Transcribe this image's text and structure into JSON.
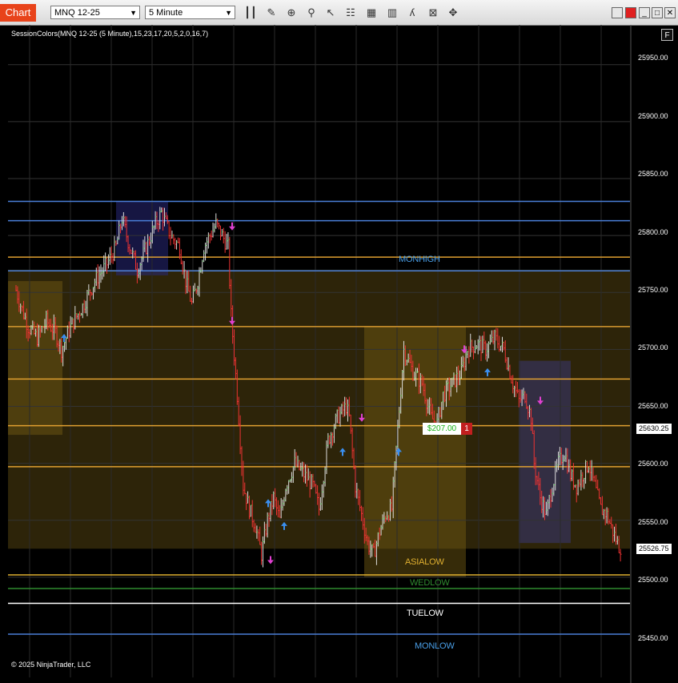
{
  "app": {
    "title": "Chart"
  },
  "toolbar": {
    "instrument": "MNQ 12-25",
    "interval": "5 Minute",
    "icons": [
      "bars-icon",
      "pencil-icon",
      "zoom-icon",
      "magnifier-icon",
      "cursor-icon",
      "chart-properties-icon",
      "data-box-icon",
      "strategy-icon",
      "indicator-icon",
      "crosshair-icon",
      "drawing-tools-icon",
      "close-icon",
      "window-icon"
    ]
  },
  "chart": {
    "indicator_label": "SessionColors(MNQ 12-25 (5 Minute),15,23,17,20,5,2,0,16,7)",
    "copyright": "© 2025 NinjaTrader, LLC",
    "f_button": "F",
    "price_ticks": [
      "25950.00",
      "25900.00",
      "25850.00",
      "25800.00",
      "25750.00",
      "25700.00",
      "25650.00",
      "25600.00",
      "25550.00",
      "25500.00",
      "25450.00"
    ],
    "price_tags": [
      "25630.25",
      "25526.75"
    ],
    "level_labels": [
      {
        "text": "MONHIGH",
        "color": "#4a9fe8"
      },
      {
        "text": "ASIALOW",
        "color": "#e0b030"
      },
      {
        "text": "WEDLOW",
        "color": "#2f8a2f"
      },
      {
        "text": "TUELOW",
        "color": "#ffffff"
      },
      {
        "text": "MONLOW",
        "color": "#4a9fe8"
      }
    ],
    "position": {
      "pnl": "$207.00",
      "quantity": "1"
    }
  },
  "chart_data": {
    "type": "candlestick",
    "instrument": "MNQ 12-25",
    "interval": "5 Minute",
    "ylim": [
      25412,
      25985
    ],
    "yticks": [
      25950,
      25900,
      25850,
      25800,
      25750,
      25700,
      25650,
      25600,
      25550,
      25500,
      25450
    ],
    "current_price": 25526.75,
    "entry_price": 25630.25,
    "levels": [
      {
        "name": "MONHIGH",
        "price": 25781,
        "color": "#e0a030"
      },
      {
        "name": "ASIALOW",
        "price": 25502,
        "color": "#e0b030"
      },
      {
        "name": "WEDLOW",
        "price": 25490,
        "color": "#2f8a2f"
      },
      {
        "name": "TUELOW",
        "price": 25477,
        "color": "#ffffff"
      },
      {
        "name": "MONLOW",
        "price": 25450,
        "color": "#4a9fe8"
      }
    ],
    "price_path": [
      [
        0,
        25752
      ],
      [
        4,
        25735
      ],
      [
        8,
        25720
      ],
      [
        14,
        25710
      ],
      [
        20,
        25725
      ],
      [
        26,
        25715
      ],
      [
        30,
        25700
      ],
      [
        36,
        25720
      ],
      [
        44,
        25738
      ],
      [
        52,
        25760
      ],
      [
        60,
        25775
      ],
      [
        66,
        25790
      ],
      [
        70,
        25815
      ],
      [
        74,
        25795
      ],
      [
        80,
        25770
      ],
      [
        86,
        25790
      ],
      [
        92,
        25810
      ],
      [
        96,
        25820
      ],
      [
        102,
        25800
      ],
      [
        108,
        25790
      ],
      [
        112,
        25760
      ],
      [
        116,
        25740
      ],
      [
        120,
        25760
      ],
      [
        124,
        25790
      ],
      [
        128,
        25800
      ],
      [
        132,
        25810
      ],
      [
        136,
        25800
      ],
      [
        140,
        25790
      ],
      [
        142,
        25730
      ],
      [
        146,
        25660
      ],
      [
        148,
        25620
      ],
      [
        150,
        25580
      ],
      [
        154,
        25560
      ],
      [
        158,
        25545
      ],
      [
        162,
        25520
      ],
      [
        166,
        25550
      ],
      [
        170,
        25570
      ],
      [
        174,
        25550
      ],
      [
        178,
        25580
      ],
      [
        184,
        25600
      ],
      [
        190,
        25590
      ],
      [
        196,
        25580
      ],
      [
        200,
        25560
      ],
      [
        206,
        25620
      ],
      [
        212,
        25640
      ],
      [
        218,
        25650
      ],
      [
        220,
        25640
      ],
      [
        224,
        25580
      ],
      [
        228,
        25555
      ],
      [
        232,
        25530
      ],
      [
        236,
        25520
      ],
      [
        240,
        25540
      ],
      [
        244,
        25555
      ],
      [
        248,
        25560
      ],
      [
        252,
        25630
      ],
      [
        256,
        25700
      ],
      [
        262,
        25680
      ],
      [
        268,
        25670
      ],
      [
        274,
        25640
      ],
      [
        278,
        25635
      ],
      [
        282,
        25660
      ],
      [
        288,
        25670
      ],
      [
        294,
        25680
      ],
      [
        298,
        25700
      ],
      [
        304,
        25705
      ],
      [
        310,
        25700
      ],
      [
        316,
        25710
      ],
      [
        322,
        25700
      ],
      [
        328,
        25670
      ],
      [
        332,
        25655
      ],
      [
        336,
        25660
      ],
      [
        340,
        25640
      ],
      [
        342,
        25600
      ],
      [
        346,
        25570
      ],
      [
        350,
        25555
      ],
      [
        354,
        25580
      ],
      [
        358,
        25600
      ],
      [
        362,
        25610
      ],
      [
        366,
        25590
      ],
      [
        370,
        25580
      ],
      [
        374,
        25590
      ],
      [
        378,
        25600
      ],
      [
        382,
        25580
      ],
      [
        386,
        25560
      ],
      [
        390,
        25555
      ],
      [
        394,
        25540
      ],
      [
        398,
        25526.75
      ]
    ],
    "bar_count": 400
  }
}
